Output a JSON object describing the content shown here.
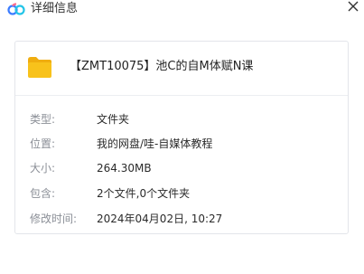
{
  "window": {
    "title": "详细信息",
    "app_icon": "cloud-icon",
    "close_icon": "close-icon"
  },
  "file": {
    "icon": "folder-icon",
    "name": "【ZMT10075】池C的自M体赋N课"
  },
  "details": [
    {
      "label": "类型:",
      "value": "文件夹"
    },
    {
      "label": "位置:",
      "value": "我的网盘/哇-自媒体教程"
    },
    {
      "label": "大小:",
      "value": "264.30MB"
    },
    {
      "label": "包含:",
      "value": "2个文件,0个文件夹"
    },
    {
      "label": "修改时间:",
      "value": "2024年04月02日, 10:27"
    }
  ],
  "colors": {
    "folder": "#f8c21b",
    "folder_back": "#f0ad0f",
    "cloud_blue": "#3b7cff",
    "cloud_cyan": "#23c5e8",
    "cloud_pink": "#ff6a8a"
  }
}
